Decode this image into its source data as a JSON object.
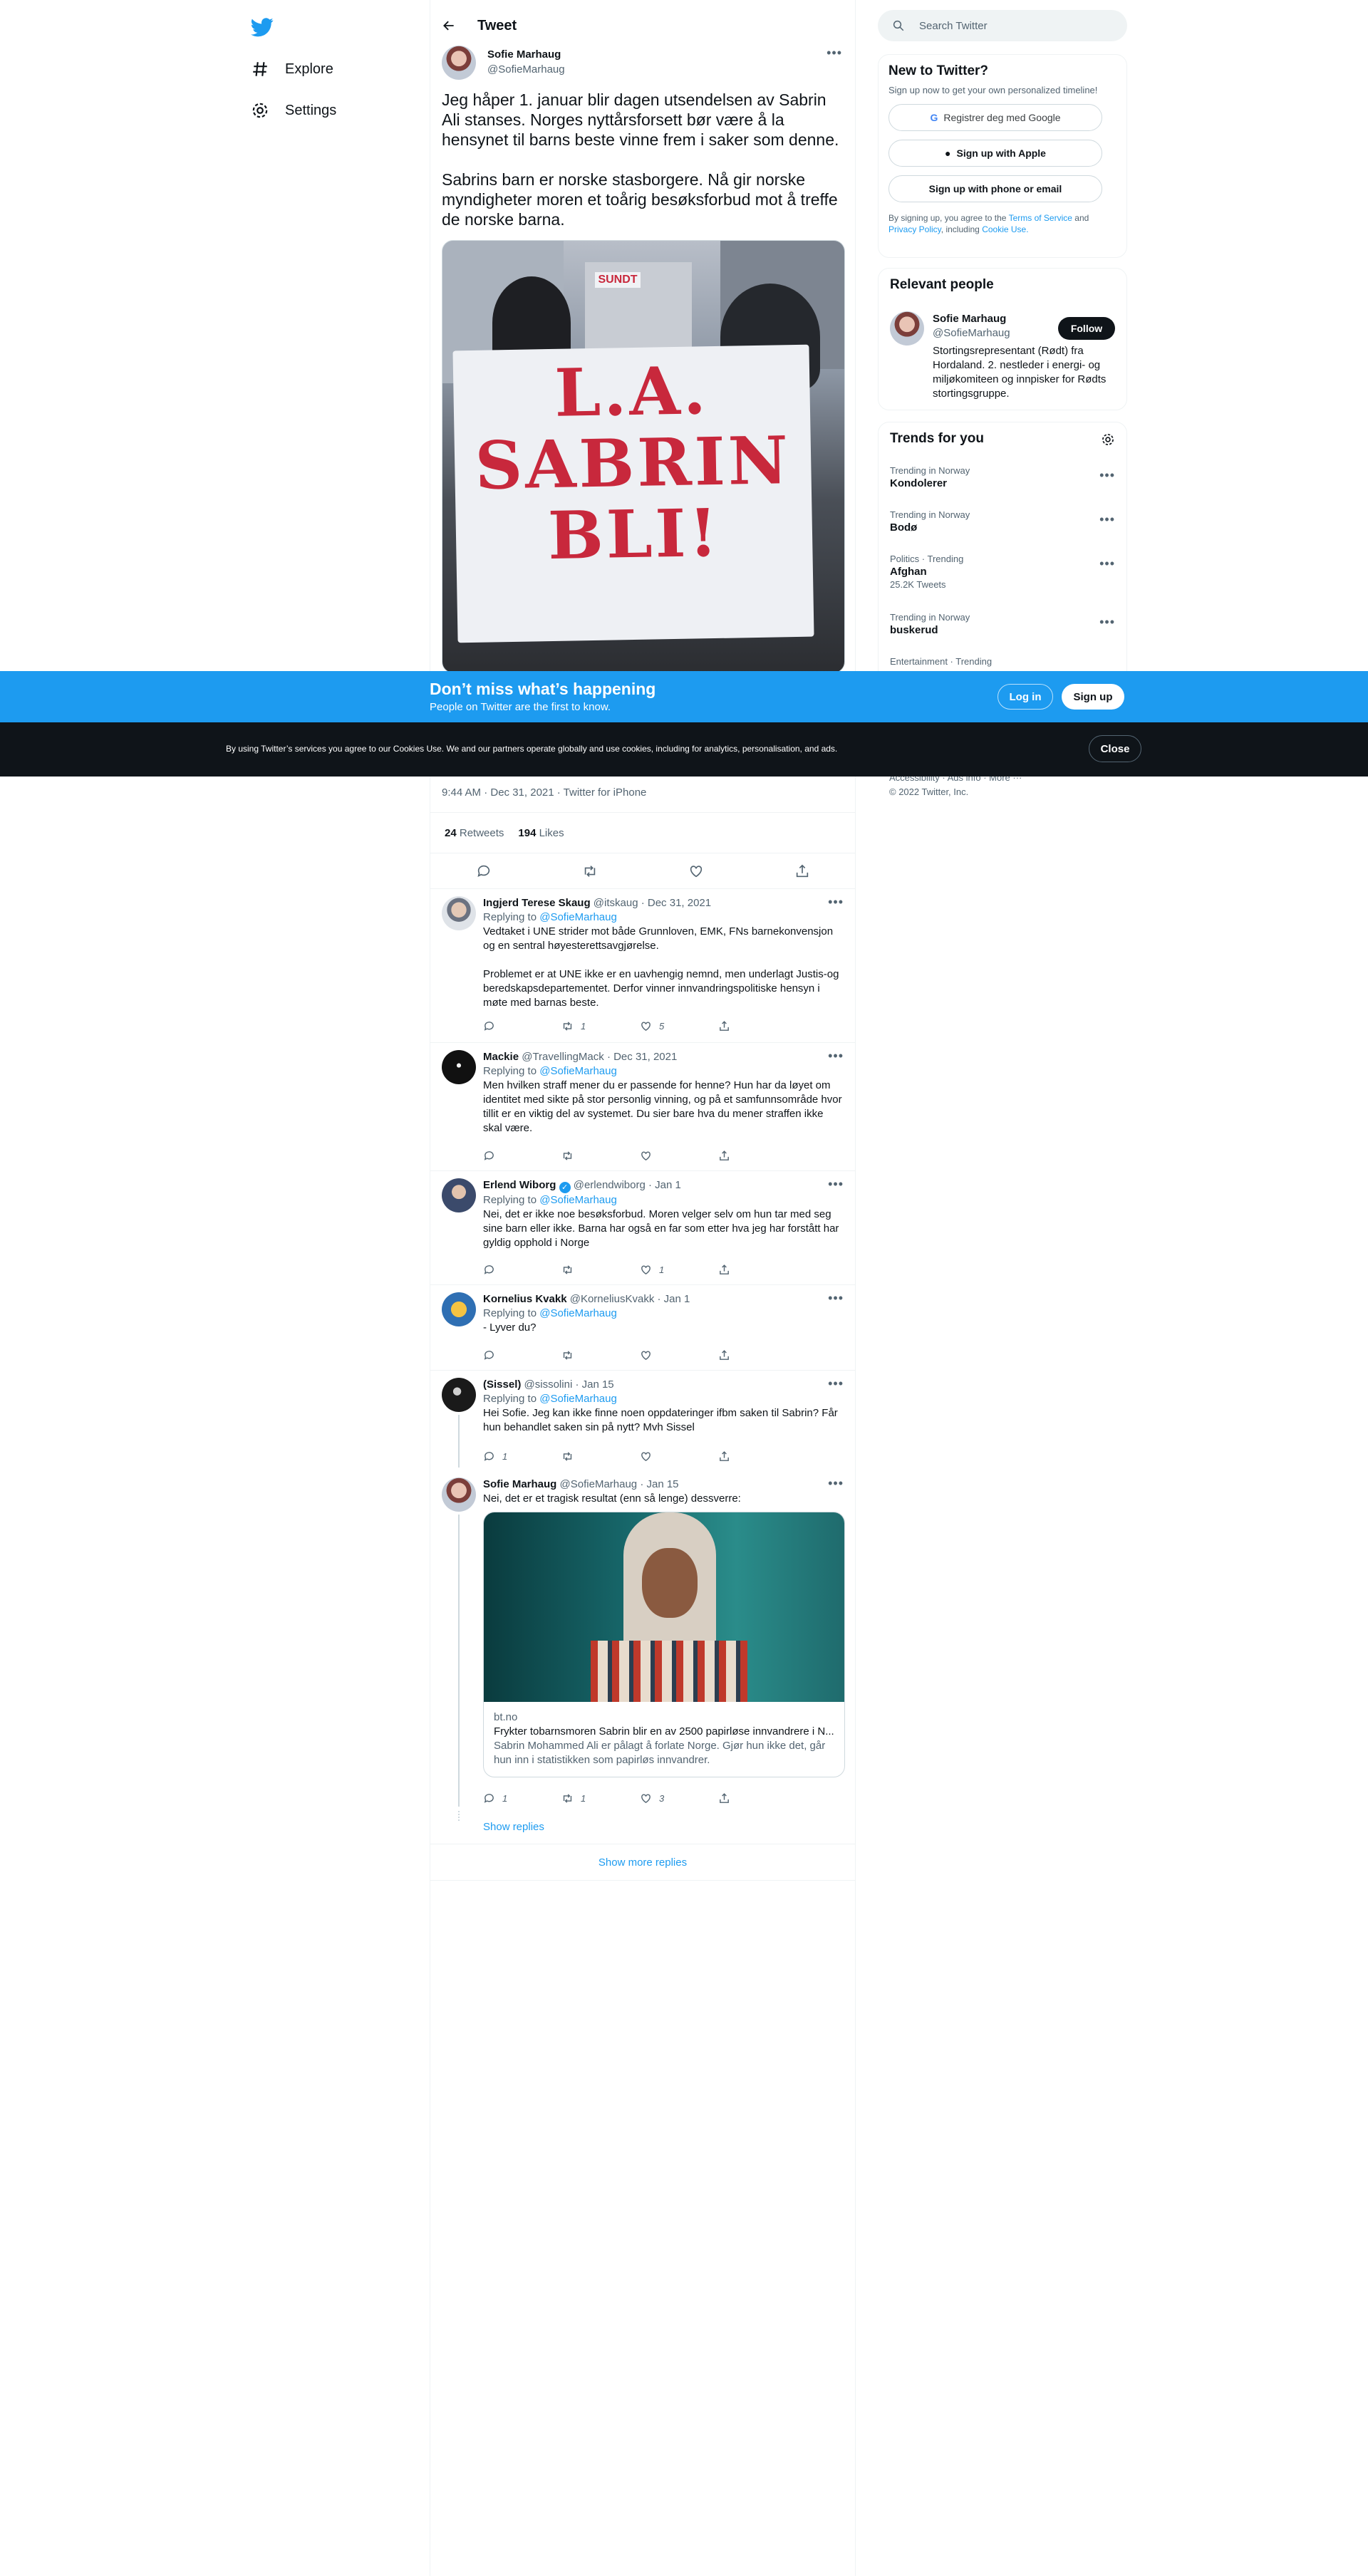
{
  "nav": {
    "explore": "Explore",
    "settings": "Settings"
  },
  "header": {
    "title": "Tweet"
  },
  "tweet": {
    "author_name": "Sofie Marhaug",
    "author_handle": "@SofieMarhaug",
    "text": "Jeg håper 1. januar blir dagen utsendelsen av Sabrin Ali stanses. Norges nyttårsforsett bør være å la hensynet til barns beste vinne frem i saker som denne.\n\nSabrins barn er norske stasborgere. Nå gir norske myndigheter moren et toårig besøksforbud mot å treffe de norske barna.",
    "banner_lines": [
      "L.A.",
      "SABRIN",
      "BLI!"
    ],
    "shop_sign": "SUNDT",
    "timestamp": "9:44 AM · Dec 31, 2021 · Twitter for iPhone",
    "retweets": "24",
    "retweets_label": "Retweets",
    "likes": "194",
    "likes_label": "Likes"
  },
  "replies": [
    {
      "name": "Ingjerd Terese Skaug",
      "handle": "@itskaug",
      "date": "· Dec 31, 2021",
      "replying": "Replying to",
      "replying_to": "@SofieMarhaug",
      "text": "Vedtaket i UNE strider mot både Grunnloven, EMK, FNs barnekonvensjon og  en sentral høyesterettsavgjørelse.\n\nProblemet er at UNE ikke er en uavhengig nemnd, men underlagt Justis-og beredskapsdepartementet. Derfor vinner innvandringspolitiske hensyn i møte med barnas beste.",
      "reply_count": "",
      "retweet_count": "1",
      "like_count": "5"
    },
    {
      "name": "Mackie",
      "handle": "@TravellingMack",
      "date": "· Dec 31, 2021",
      "replying": "Replying to",
      "replying_to": "@SofieMarhaug",
      "text": "Men hvilken straff mener du er passende for henne? Hun har da løyet om identitet med sikte på stor personlig vinning, og på et samfunnsområde hvor tillit er en viktig del av systemet. Du sier bare hva du mener straffen ikke skal være.",
      "reply_count": "",
      "retweet_count": "",
      "like_count": ""
    },
    {
      "name": "Erlend Wiborg",
      "handle": "@erlendwiborg",
      "date": "· Jan 1",
      "replying": "Replying to",
      "replying_to": "@SofieMarhaug",
      "text": "Nei, det er ikke noe besøksforbud. Moren velger selv om hun tar med seg sine barn eller ikke. Barna har også en far som etter hva jeg har forstått har gyldig opphold i Norge",
      "reply_count": "",
      "retweet_count": "",
      "like_count": "1"
    },
    {
      "name": "Kornelius Kvakk",
      "handle": "@KorneliusKvakk",
      "date": "· Jan 1",
      "replying": "Replying to",
      "replying_to": "@SofieMarhaug",
      "text": "- Lyver du?",
      "reply_count": "",
      "retweet_count": "",
      "like_count": ""
    },
    {
      "name": "(Sissel)",
      "handle": "@sissolini",
      "date": "· Jan 15",
      "replying": "Replying to",
      "replying_to": "@SofieMarhaug",
      "text": "Hei Sofie. Jeg kan ikke finne noen oppdateringer ifbm saken til Sabrin? Får hun behandlet saken sin på nytt? Mvh Sissel",
      "reply_count": "1",
      "retweet_count": "",
      "like_count": ""
    },
    {
      "name": "Sofie Marhaug",
      "handle": "@SofieMarhaug",
      "date": "· Jan 15",
      "text": "Nei, det er et tragisk resultat (enn så lenge) dessverre:",
      "reply_count": "1",
      "retweet_count": "1",
      "like_count": "3",
      "card": {
        "domain": "bt.no",
        "title": "Frykter tobarnsmoren Sabrin blir en av 2500 papirløse innvandrere i N...",
        "description": "Sabrin Mohammed Ali er pålagt å forlate Norge. Gjør hun ikke det, går hun inn i statistikken som papirløs innvandrer."
      }
    }
  ],
  "show_replies": "Show replies",
  "show_more_replies": "Show more replies",
  "search": {
    "placeholder": "Search Twitter"
  },
  "new_to_twitter": {
    "title": "New to Twitter?",
    "subtitle": "Sign up now to get your own personalized timeline!",
    "google": "Registrer deg med Google",
    "apple": "Sign up with Apple",
    "phone": "Sign up with phone or email",
    "legal_1": "By signing up, you agree to the",
    "terms": "Terms of Service",
    "and": "and",
    "privacy": "Privacy Policy",
    "including": ", including",
    "cookie": "Cookie Use."
  },
  "relevant": {
    "title": "Relevant people",
    "name": "Sofie Marhaug",
    "handle": "@SofieMarhaug",
    "follow": "Follow",
    "bio": "Stortingsrepresentant (Rødt) fra Hordaland. 2. nestleder i energi- og miljøkomiteen og innpisker for Rødts stortingsgruppe."
  },
  "trends": {
    "title": "Trends for you",
    "items": [
      {
        "category": "Trending in Norway",
        "name": "Kondolerer",
        "count": ""
      },
      {
        "category": "Trending in Norway",
        "name": "Bodø",
        "count": ""
      },
      {
        "category": "Politics · Trending",
        "name": "Afghan",
        "count": "25.2K Tweets"
      },
      {
        "category": "Trending in Norway",
        "name": "buskerud",
        "count": ""
      },
      {
        "category": "Entertainment · Trending",
        "name": "",
        "count": ""
      }
    ]
  },
  "footer": {
    "line1": "Accessibility · Ads info · More ···",
    "line2": "© 2022 Twitter, Inc."
  },
  "signup_bar": {
    "headline": "Don’t miss what’s happening",
    "sub": "People on Twitter are the first to know.",
    "login": "Log in",
    "signup": "Sign up"
  },
  "cookie_bar": {
    "text": "By using Twitter’s services you agree to our Cookies Use. We and our partners operate globally and use cookies, including for analytics, personalisation, and ads.",
    "close": "Close"
  },
  "colors": {
    "brand": "#1d9bf0",
    "text": "#0f1419",
    "muted": "#536471",
    "dark_bar": "#0f1419"
  }
}
